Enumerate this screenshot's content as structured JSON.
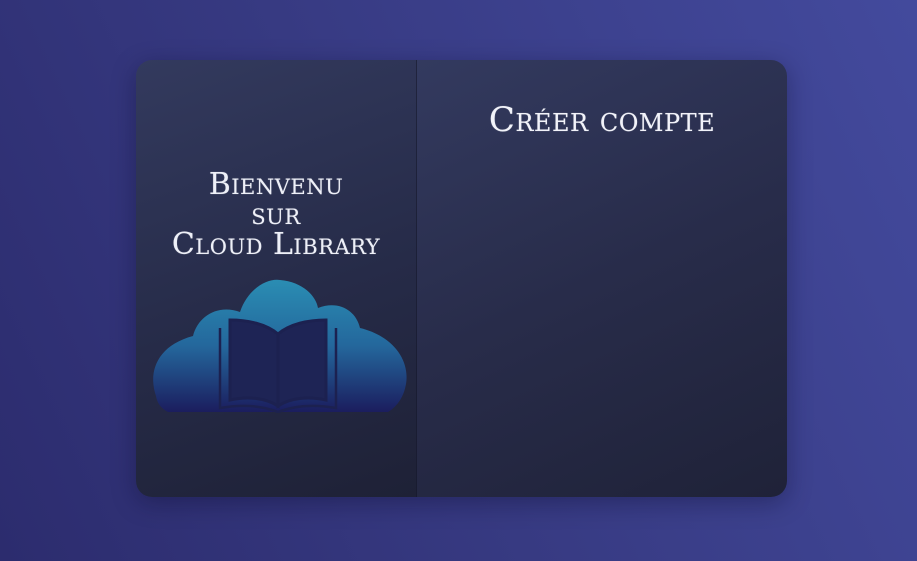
{
  "welcome": {
    "line1": "Bienvenu",
    "line2": "sur",
    "line3": "Cloud Library"
  },
  "form": {
    "title": "Créer compte"
  },
  "logo": {
    "icon": "cloud-book-icon",
    "colors": {
      "cloud_top": "#2a8db3",
      "cloud_bottom": "#1b1d5e",
      "book": "#1c2150"
    }
  },
  "colors": {
    "background": "#373a82",
    "card": "#282c4a",
    "text": "#eef0f8"
  }
}
